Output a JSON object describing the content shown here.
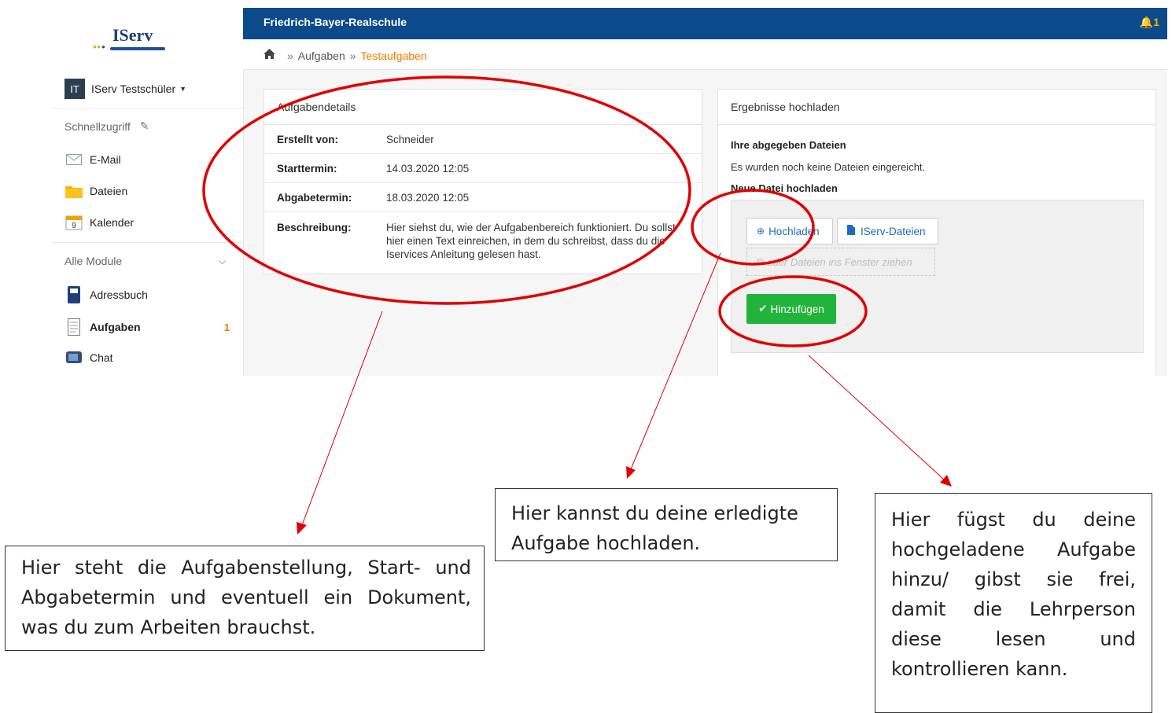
{
  "sidebar": {
    "logo_text": "IServ",
    "user": {
      "initials": "IT",
      "name": "IServ Testschüler"
    },
    "quick_access_label": "Schnellzugriff",
    "quick_items": [
      {
        "label": "E-Mail",
        "icon": "envelope-icon"
      },
      {
        "label": "Dateien",
        "icon": "folder-icon"
      },
      {
        "label": "Kalender",
        "icon": "calendar-icon",
        "icon_text": "9"
      }
    ],
    "all_modules_label": "Alle Module",
    "modules": [
      {
        "label": "Adressbuch",
        "icon": "addressbook-icon"
      },
      {
        "label": "Aufgaben",
        "icon": "tasks-icon",
        "count": "1"
      },
      {
        "label": "Chat",
        "icon": "chat-icon"
      }
    ]
  },
  "topbar": {
    "school": "Friedrich-Bayer-Realschule",
    "notification_count": "1"
  },
  "breadcrumb": {
    "item1": "Aufgaben",
    "sep": "»",
    "current": "Testaufgaben"
  },
  "details": {
    "title": "Aufgabendetails",
    "rows": [
      {
        "key": "Erstellt von:",
        "value": "Schneider"
      },
      {
        "key": "Starttermin:",
        "value": "14.03.2020 12:05"
      },
      {
        "key": "Abgabetermin:",
        "value": "18.03.2020 12:05"
      },
      {
        "key": "Beschreibung:",
        "value": "Hier siehst du, wie der Aufgabenbereich funktioniert. Du sollst hier einen Text einreichen, in dem du schreibst, dass du die Iservices Anleitung gelesen hast."
      }
    ]
  },
  "upload": {
    "title": "Ergebnisse hochladen",
    "submitted_label": "Ihre abgegeben Dateien",
    "submitted_text": "Es wurden noch keine Dateien eingereicht.",
    "new_label": "Neue Datei hochladen",
    "upload_button": "Hochladen",
    "iserv_button": "IServ-Dateien",
    "drop_text": "oder Dateien ins Fenster ziehen",
    "add_button": "Hinzufügen"
  },
  "annotations": {
    "note1": "Hier steht die Aufgabenstellung, Start- und Abgabetermin und eventuell ein Dokument, was du zum Arbeiten brauchst.",
    "note2": "Hier kannst du deine erledigte Aufgabe hochladen.",
    "note3": "Hier fügst du deine hochgeladene Aufgabe hinzu/ gibst sie frei, damit die Lehrperson diese lesen und kontrollieren kann.",
    "color": "#e00000"
  },
  "colors": {
    "topbar": "#0b4a8b",
    "accent": "#f07c00",
    "success": "#21b33a",
    "link": "#1e6bc2"
  }
}
